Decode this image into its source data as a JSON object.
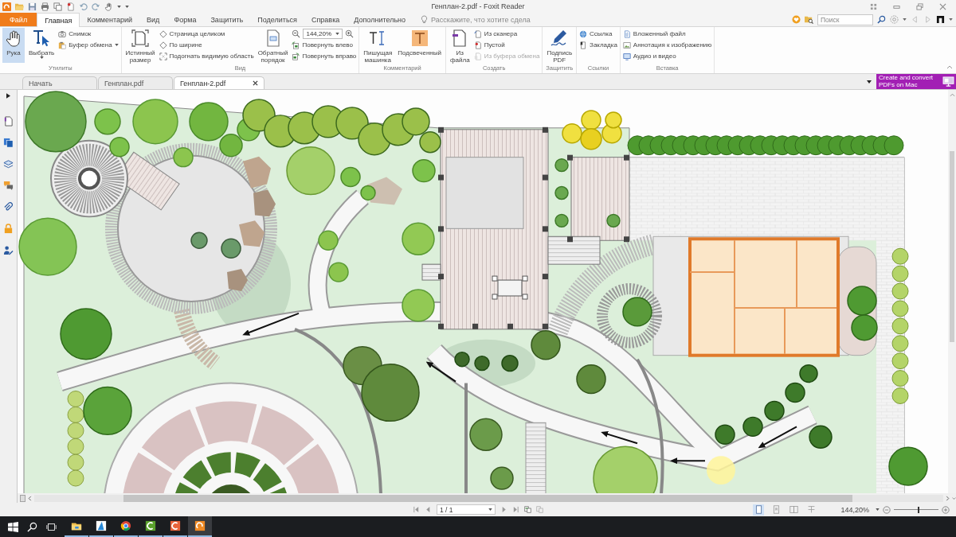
{
  "window": {
    "title": "Генплан-2.pdf - Foxit Reader"
  },
  "menu_tabs": [
    {
      "label": "Файл",
      "kind": "file",
      "selected": false
    },
    {
      "label": "Главная",
      "kind": "tab",
      "selected": true
    },
    {
      "label": "Комментарий",
      "kind": "tab",
      "selected": false
    },
    {
      "label": "Вид",
      "kind": "tab",
      "selected": false
    },
    {
      "label": "Форма",
      "kind": "tab",
      "selected": false
    },
    {
      "label": "Защитить",
      "kind": "tab",
      "selected": false
    },
    {
      "label": "Поделиться",
      "kind": "tab",
      "selected": false
    },
    {
      "label": "Справка",
      "kind": "tab",
      "selected": false
    },
    {
      "label": "Дополнительно",
      "kind": "tab",
      "selected": false
    }
  ],
  "tell_me": {
    "placeholder": "Расскажите, что хотите сдела"
  },
  "search": {
    "placeholder": "Поиск"
  },
  "ribbon": {
    "groups": [
      {
        "label": "Утилиты",
        "items": [
          {
            "kind": "large",
            "label": "Рука",
            "selected": true
          },
          {
            "kind": "large",
            "label": "Выбрать",
            "selected": false,
            "dropdown": true
          },
          {
            "kind": "stack",
            "items": [
              {
                "kind": "small",
                "label": "Снимок"
              },
              {
                "kind": "small",
                "label": "Буфер обмена",
                "dropdown": true
              }
            ]
          }
        ]
      },
      {
        "label": "Вид",
        "items": [
          {
            "kind": "large",
            "label": "Истинный размер"
          },
          {
            "kind": "stack",
            "items": [
              {
                "kind": "small",
                "label": "Страница целиком"
              },
              {
                "kind": "small",
                "label": "По ширине"
              },
              {
                "kind": "small",
                "label": "Подогнать видимую область"
              }
            ]
          },
          {
            "kind": "large",
            "label": "Обратный порядок"
          },
          {
            "kind": "stack",
            "items": [
              {
                "kind": "zoom",
                "value": "144,20%"
              },
              {
                "kind": "small",
                "label": "Повернуть влево"
              },
              {
                "kind": "small",
                "label": "Повернуть вправо"
              }
            ]
          }
        ]
      },
      {
        "label": "Комментарий",
        "items": [
          {
            "kind": "large",
            "label": "Пишущая машинка"
          },
          {
            "kind": "large",
            "label": "Подсвеченный"
          }
        ]
      },
      {
        "label": "Создать",
        "items": [
          {
            "kind": "large",
            "label": "Из файла"
          },
          {
            "kind": "stack",
            "items": [
              {
                "kind": "small",
                "label": "Из сканера",
                "disabled": false
              },
              {
                "kind": "small",
                "label": "Пустой",
                "disabled": false
              },
              {
                "kind": "small",
                "label": "Из буфера обмена",
                "disabled": true
              }
            ]
          }
        ]
      },
      {
        "label": "Защитить",
        "items": [
          {
            "kind": "large",
            "label": "Подпись PDF"
          }
        ]
      },
      {
        "label": "Ссылки",
        "items": [
          {
            "kind": "stack",
            "items": [
              {
                "kind": "small",
                "label": "Ссылка"
              },
              {
                "kind": "small",
                "label": "Закладка"
              }
            ]
          }
        ]
      },
      {
        "label": "Вставка",
        "items": [
          {
            "kind": "stack",
            "items": [
              {
                "kind": "small",
                "label": "Вложенный файл"
              },
              {
                "kind": "small",
                "label": "Аннотация к изображению"
              },
              {
                "kind": "small",
                "label": "Аудио и видео"
              }
            ]
          }
        ]
      }
    ]
  },
  "doc_tabs": [
    {
      "label": "Начать",
      "selected": false
    },
    {
      "label": "Генплан.pdf",
      "selected": false
    },
    {
      "label": "Генплан-2.pdf",
      "selected": true
    }
  ],
  "promo": {
    "text": "Create and convert PDFs on Mac"
  },
  "status_bar": {
    "page": "1 / 1",
    "view_modes": [
      {
        "selected": true
      },
      {
        "selected": false
      },
      {
        "selected": false
      },
      {
        "selected": false
      }
    ],
    "zoom": "144,20%",
    "zoom_slider": {
      "level": 0.55
    }
  },
  "taskbar": {
    "apps": [
      {
        "selected": false
      },
      {
        "selected": false
      },
      {
        "selected": false
      },
      {
        "selected": false
      },
      {
        "selected": false
      },
      {
        "selected": true
      }
    ]
  }
}
